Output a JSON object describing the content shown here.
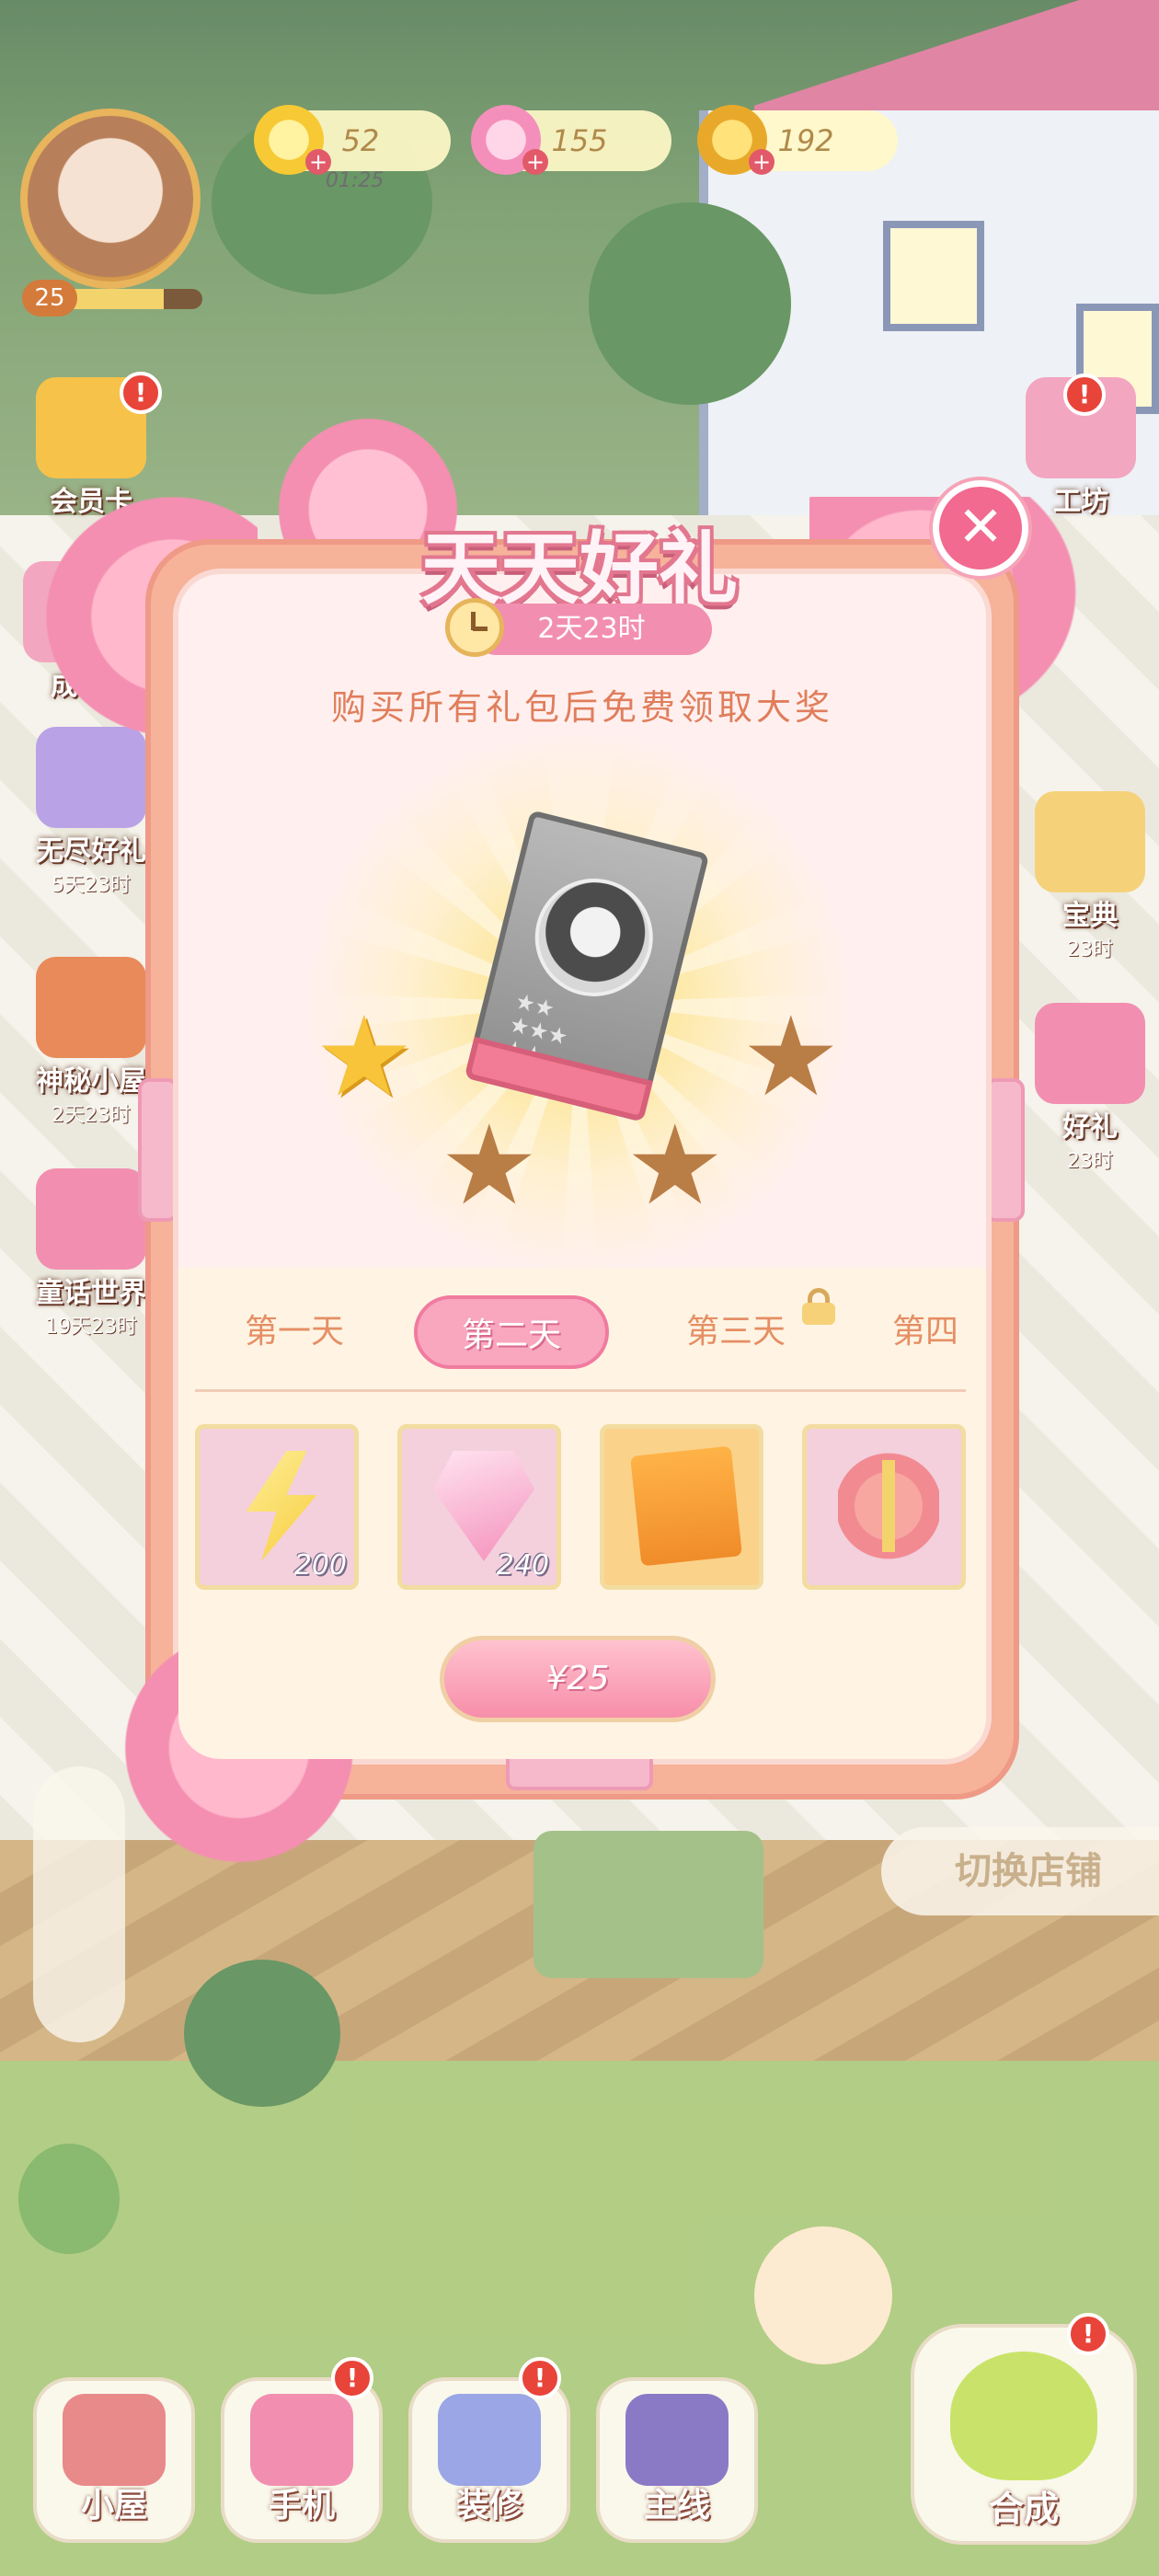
{
  "hud": {
    "level": "25",
    "xp_fraction": 0.72,
    "energy": "52",
    "energy_timer": "01:25",
    "gems": "155",
    "coins": "192"
  },
  "side_left": [
    {
      "label": "会员卡",
      "time": ""
    },
    {
      "label": "成长",
      "time": ""
    },
    {
      "label": "无尽好礼",
      "time": "5天23时"
    },
    {
      "label": "神秘小屋",
      "time": "2天23时"
    },
    {
      "label": "童话世界",
      "time": "19天23时"
    }
  ],
  "side_right": [
    {
      "label": "工坊",
      "time": ""
    },
    {
      "label": "宝典",
      "time": "23时"
    },
    {
      "label": "好礼",
      "time": "23时"
    }
  ],
  "modal": {
    "title": "天天好礼",
    "timer": "2天23时",
    "subtitle": "购买所有礼包后免费领取大奖",
    "tabs": [
      "第一天",
      "第二天",
      "第三天",
      "第四"
    ],
    "active_tab": 1,
    "items": [
      {
        "name": "energy",
        "qty": "200"
      },
      {
        "name": "gem",
        "qty": "240"
      },
      {
        "name": "card-pack",
        "qty": ""
      },
      {
        "name": "gift-box",
        "qty": ""
      }
    ],
    "price": "¥25",
    "close_symbol": "✕"
  },
  "switch_store": "切换店铺",
  "nav": {
    "house": "小屋",
    "phone": "手机",
    "decorate": "装修",
    "main_quest": "主线",
    "merge": "合成"
  },
  "badges": {
    "exclaim": "!"
  },
  "colors": {
    "accent_pink": "#f28fb0",
    "title_outline": "#e2778f",
    "text_orange": "#e07e5c",
    "alert_red": "#e8443a"
  }
}
